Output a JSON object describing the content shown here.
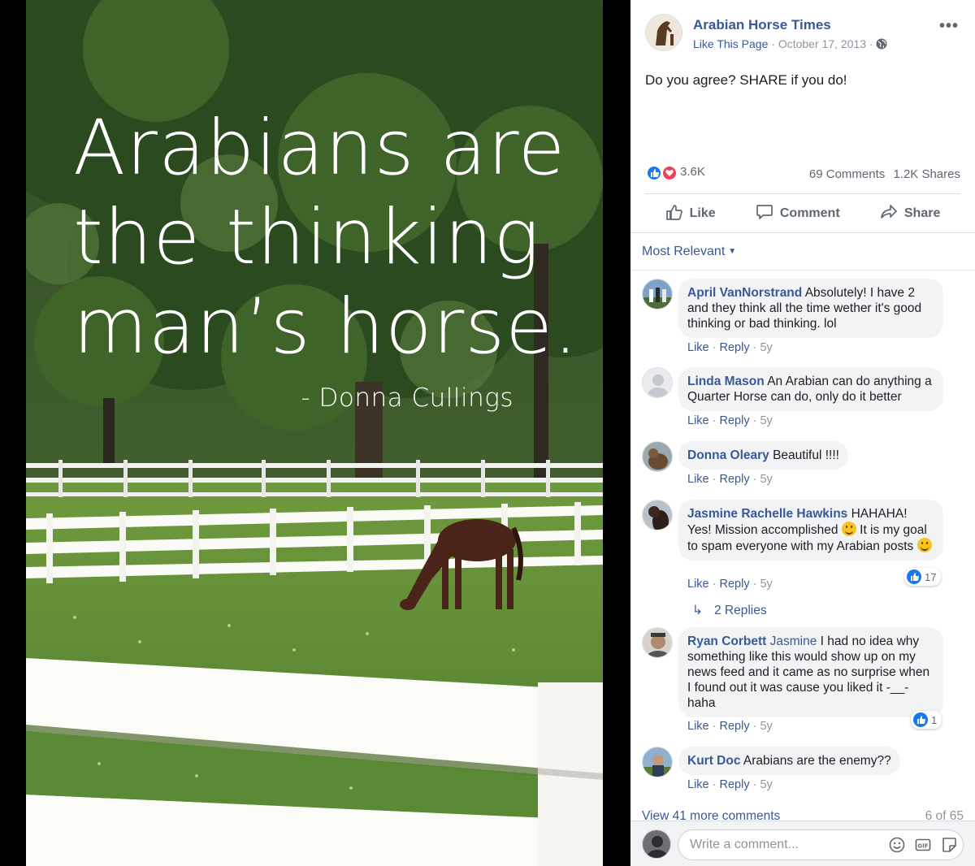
{
  "photo": {
    "quote_line1": "Arabians are",
    "quote_line2": "the thinking",
    "quote_line3": "man’s horse.",
    "author": "- Donna Cullings"
  },
  "post": {
    "page_name": "Arabian Horse Times",
    "like_page": "Like This Page",
    "separator": "·",
    "date": "October 17, 2013",
    "text": "Do you agree? SHARE if you do!",
    "reactions_count": "3.6K",
    "comments_count": "69 Comments",
    "shares_count": "1.2K Shares",
    "actions": {
      "like": "Like",
      "comment": "Comment",
      "share": "Share"
    },
    "sort_label": "Most Relevant"
  },
  "comments": [
    {
      "author": "April VanNorstrand",
      "text": "Absolutely! I have 2 and they think all the time wether it's good thinking or bad thinking. lol",
      "like": "Like",
      "reply": "Reply",
      "time": "5y"
    },
    {
      "author": "Linda Mason",
      "text": "An Arabian can do anything a Quarter Horse can do, only do it better",
      "like": "Like",
      "reply": "Reply",
      "time": "5y"
    },
    {
      "author": "Donna Oleary",
      "text": "Beautiful !!!!",
      "like": "Like",
      "reply": "Reply",
      "time": "5y"
    },
    {
      "author": "Jasmine Rachelle Hawkins",
      "text_a": "HAHAHA! Yes! Mission accomplished",
      "text_b": "It is my goal to spam everyone with my Arabian posts",
      "like": "Like",
      "reply": "Reply",
      "time": "5y",
      "reactions": "17",
      "replies": "2 Replies"
    },
    {
      "author": "Ryan Corbett",
      "mention": "Jasmine",
      "text": "I had no idea why something like this would show up on my news feed and it came as no surprise when I found out it was cause you liked it -__- haha",
      "like": "Like",
      "reply": "Reply",
      "time": "5y",
      "reactions": "1"
    },
    {
      "author": "Kurt Doc",
      "text": "Arabians are the enemy??",
      "like": "Like",
      "reply": "Reply",
      "time": "5y"
    }
  ],
  "footer": {
    "view_more": "View 41 more comments",
    "page_count": "6 of 65",
    "write_placeholder": "Write a comment..."
  },
  "colors": {
    "link": "#385898",
    "like_blue": "#1877f2",
    "love_red": "#f33e58",
    "bubble": "#f2f3f5"
  },
  "icons": [
    "globe-icon",
    "more-icon",
    "like-reaction-icon",
    "love-reaction-icon",
    "thumbs-up-icon",
    "comment-icon",
    "share-icon",
    "caret-down-icon",
    "reply-arrow-icon",
    "emoji-icon",
    "gif-icon",
    "sticker-icon"
  ]
}
